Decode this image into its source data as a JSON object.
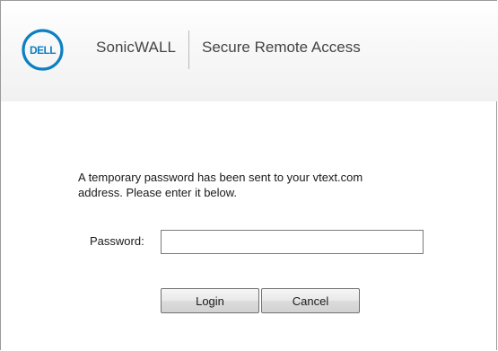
{
  "header": {
    "logo_text": "DELL",
    "brand": "SonicWALL",
    "subtitle": "Secure Remote Access"
  },
  "message": {
    "line1": "A temporary password has been sent to your vtext.com",
    "line2": "address. Please enter it below."
  },
  "form": {
    "password_label": "Password:",
    "password_value": ""
  },
  "buttons": {
    "login": "Login",
    "cancel": "Cancel"
  },
  "colors": {
    "logo_blue": "#0d7fc3",
    "text": "#444444"
  }
}
